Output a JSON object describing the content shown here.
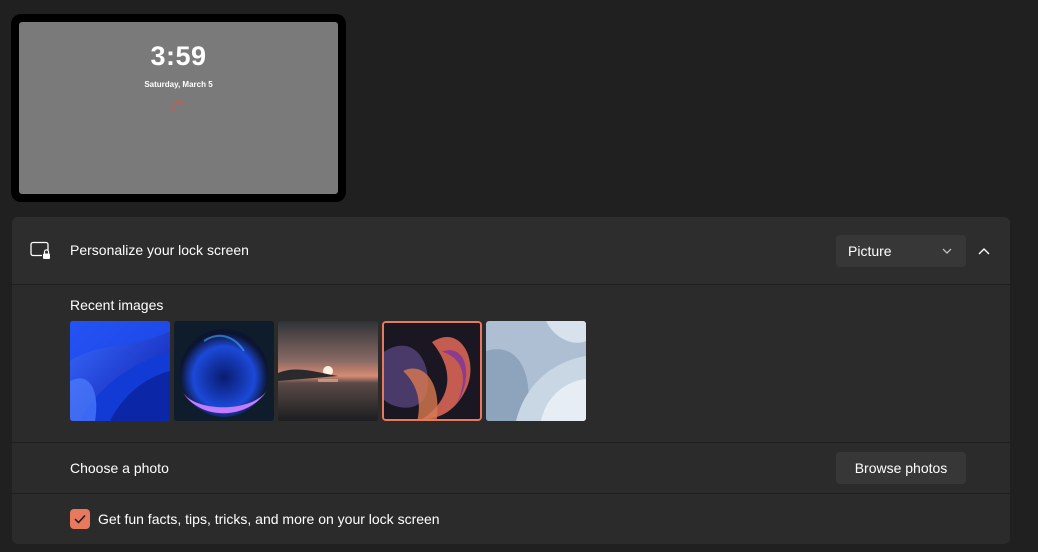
{
  "preview": {
    "time": "3:59",
    "date": "Saturday, March 5"
  },
  "lock_screen": {
    "title": "Personalize your lock screen",
    "icon": "lock-screen-icon",
    "select_value": "Picture",
    "collapse_icon": "chevron-up-icon"
  },
  "recent_images": {
    "label": "Recent images",
    "items": [
      {
        "name": "blue-bloom",
        "selected": false
      },
      {
        "name": "glow-orb",
        "selected": false
      },
      {
        "name": "sunset-lake",
        "selected": false
      },
      {
        "name": "purple-ribbon",
        "selected": true
      },
      {
        "name": "silver-bloom",
        "selected": false
      }
    ]
  },
  "choose_photo": {
    "label": "Choose a photo",
    "button": "Browse photos"
  },
  "fun_facts": {
    "checked": true,
    "label": "Get fun facts, tips, tricks, and more on your lock screen"
  },
  "colors": {
    "accent": "#e7795f",
    "background": "#202020",
    "card": "#2b2b2b"
  }
}
